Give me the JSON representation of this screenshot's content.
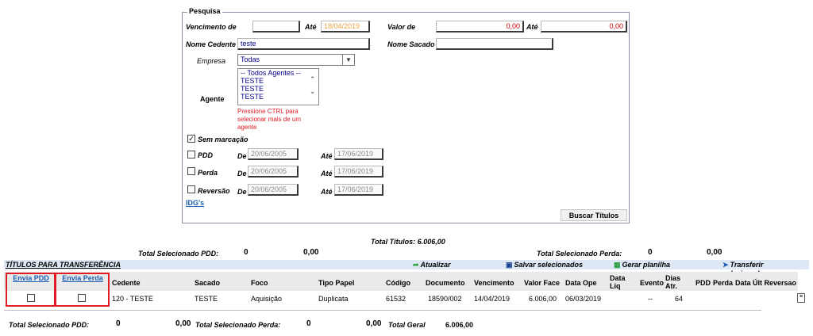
{
  "filters": {
    "legend": "Pesquisa",
    "vencimento_label": "Vencimento de",
    "ate_label": "Até",
    "vencimento_to": "18/04/2019",
    "valor_de_label": "Valor de",
    "valor_from": "0,00",
    "valor_to": "0,00",
    "nome_cedente_label": "Nome Cedente",
    "nome_cedente_value": "teste",
    "nome_sacado_label": "Nome Sacado",
    "empresa_label": "Empresa",
    "empresa_value": "Todas",
    "agente_label": "Agente",
    "agente_options": [
      "-- Todos Agentes --",
      "TESTE",
      "TESTE",
      "TESTE"
    ],
    "agente_hint": "Pressione CTRL para selecionar mais de um agente",
    "sem_marcacao_label": "Sem marcação",
    "sem_marcacao_checked": "✓",
    "pdd_label": "PDD",
    "perda_label": "Perda",
    "reversao_label": "Reversão",
    "de_label": "De",
    "date_from": "20/06/2005",
    "date_to": "17/06/2019",
    "idgs_link": "IDG's",
    "buscar_button": "Buscar Títulos"
  },
  "totals_top": {
    "total_titulos_label": "Total Títulos:",
    "total_titulos_value": "6.006,00",
    "selecionado_pdd_label": "Total Selecionado PDD:",
    "selecionado_pdd_count": "0",
    "selecionado_pdd_value": "0,00",
    "selecionado_perda_label": "Total Selecionado Perda:",
    "selecionado_perda_count": "0",
    "selecionado_perda_value": "0,00"
  },
  "toolbar": {
    "section_title": "TÍTULOS PARA TRANSFERÊNCIA",
    "atualizar": "Atualizar",
    "salvar": "Salvar selecionados",
    "gerar": "Gerar planilha",
    "transferir": "Transferir selecionados",
    "colors": {
      "bar_bg": "#dde8f4",
      "highlight": "#e01b24",
      "link": "#1a5fb4"
    }
  },
  "table": {
    "headers": {
      "envia_pdd": "Envia PDD",
      "envia_perda": "Envia Perda",
      "cedente": "Cedente",
      "sacado": "Sacado",
      "foco": "Foco",
      "tipo_papel": "Tipo Papel",
      "codigo": "Código",
      "documento": "Documento",
      "vencimento": "Vencimento",
      "valor_face": "Valor Face",
      "data_ope": "Data Ope",
      "data_liq": "Data Liq",
      "evento": "Evento",
      "dias_atr": "Dias Atr.",
      "pdd": "PDD",
      "perda": "Perda",
      "data_ult_reversao": "Data Últ Reversao"
    },
    "rows": [
      {
        "cedente": "120 - TESTE",
        "sacado": "TESTE",
        "foco": "Aquisição",
        "tipo_papel": "Duplicata",
        "codigo": "61532",
        "documento": "18590/002",
        "vencimento": "14/04/2019",
        "valor_face": "6.006,00",
        "data_ope": "06/03/2019",
        "evento": "--",
        "dias_atr": "64"
      }
    ]
  },
  "totals_bottom": {
    "selecionado_pdd_label": "Total Selecionado PDD:",
    "selecionado_pdd_count": "0",
    "selecionado_pdd_value": "0,00",
    "selecionado_perda_label": "Total Selecionado Perda:",
    "selecionado_perda_count": "0",
    "selecionado_perda_value": "0,00",
    "total_geral_label": "Total Geral",
    "total_geral_value": "6.006,00"
  }
}
